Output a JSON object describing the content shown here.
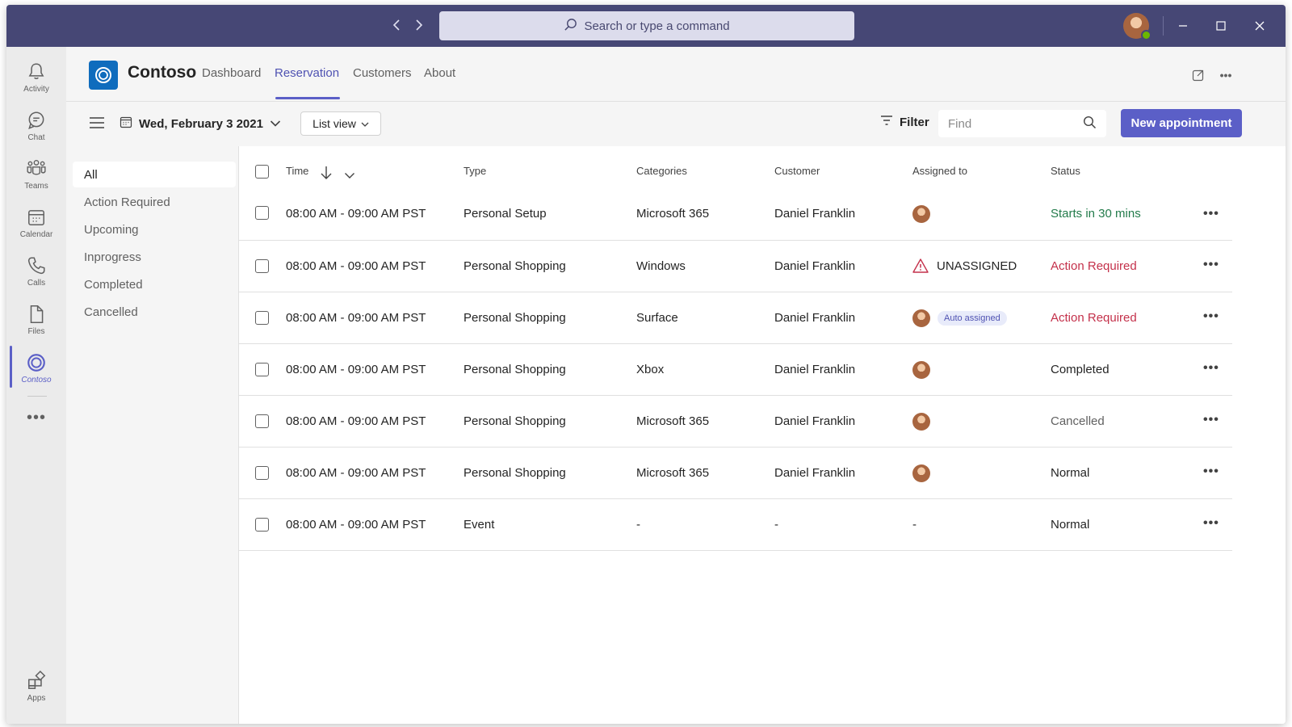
{
  "titlebar": {
    "search_placeholder": "Search or type a command",
    "back_icon": "chevron-left",
    "forward_icon": "chevron-right"
  },
  "rail": {
    "items": [
      {
        "label": "Activity",
        "icon": "bell"
      },
      {
        "label": "Chat",
        "icon": "chat-bubble"
      },
      {
        "label": "Teams",
        "icon": "people-group"
      },
      {
        "label": "Calendar",
        "icon": "calendar"
      },
      {
        "label": "Calls",
        "icon": "phone"
      },
      {
        "label": "Files",
        "icon": "document"
      },
      {
        "label": "Contoso",
        "icon": "contoso-logo",
        "active": true
      }
    ],
    "more": "•••",
    "apps": {
      "label": "Apps",
      "icon": "apps-grid"
    }
  },
  "app": {
    "name": "Contoso",
    "tabs": [
      {
        "label": "Dashboard"
      },
      {
        "label": "Reservation",
        "active": true
      },
      {
        "label": "Customers"
      },
      {
        "label": "About"
      }
    ]
  },
  "toolbar": {
    "date": "Wed, February 3 2021",
    "view": "List view",
    "filter": "Filter",
    "find_placeholder": "Find",
    "new_appointment": "New appointment"
  },
  "filters": {
    "items": [
      "All",
      "Action Required",
      "Upcoming",
      "Inprogress",
      "Completed",
      "Cancelled"
    ],
    "active": "All"
  },
  "table": {
    "headers": {
      "time": "Time",
      "type": "Type",
      "categories": "Categories",
      "customer": "Customer",
      "assigned": "Assigned to",
      "status": "Status"
    },
    "rows": [
      {
        "time": "08:00 AM - 09:00 AM PST",
        "type": "Personal Setup",
        "category": "Microsoft 365",
        "customer": "Daniel Franklin",
        "assigned": "",
        "status": "Starts in 30 mins"
      },
      {
        "time": "08:00 AM - 09:00 AM PST",
        "type": "Personal Shopping",
        "category": "Windows",
        "customer": "Daniel Franklin",
        "assigned": "UNASSIGNED",
        "status": "Action Required"
      },
      {
        "time": "08:00 AM - 09:00 AM PST",
        "type": "Personal Shopping",
        "category": "Surface",
        "customer": "Daniel Franklin",
        "assigned": "Auto assigned",
        "status": "Action Required"
      },
      {
        "time": "08:00 AM - 09:00 AM PST",
        "type": "Personal Shopping",
        "category": "Xbox",
        "customer": "Daniel Franklin",
        "assigned": "",
        "status": "Completed"
      },
      {
        "time": "08:00 AM - 09:00 AM PST",
        "type": "Personal Shopping",
        "category": "Microsoft 365",
        "customer": "Daniel Franklin",
        "assigned": "",
        "status": "Cancelled"
      },
      {
        "time": "08:00 AM - 09:00 AM PST",
        "type": "Personal Shopping",
        "category": "Microsoft 365",
        "customer": "Daniel Franklin",
        "assigned": "",
        "status": "Normal"
      },
      {
        "time": "08:00 AM - 09:00 AM PST",
        "type": "Event",
        "category": "-",
        "customer": "-",
        "assigned": "-",
        "status": "Normal"
      }
    ],
    "more": "•••"
  },
  "colors": {
    "titlebar": "#464775",
    "accent": "#5b5fc7",
    "status_green": "#237b4b",
    "status_red": "#c4314b"
  }
}
